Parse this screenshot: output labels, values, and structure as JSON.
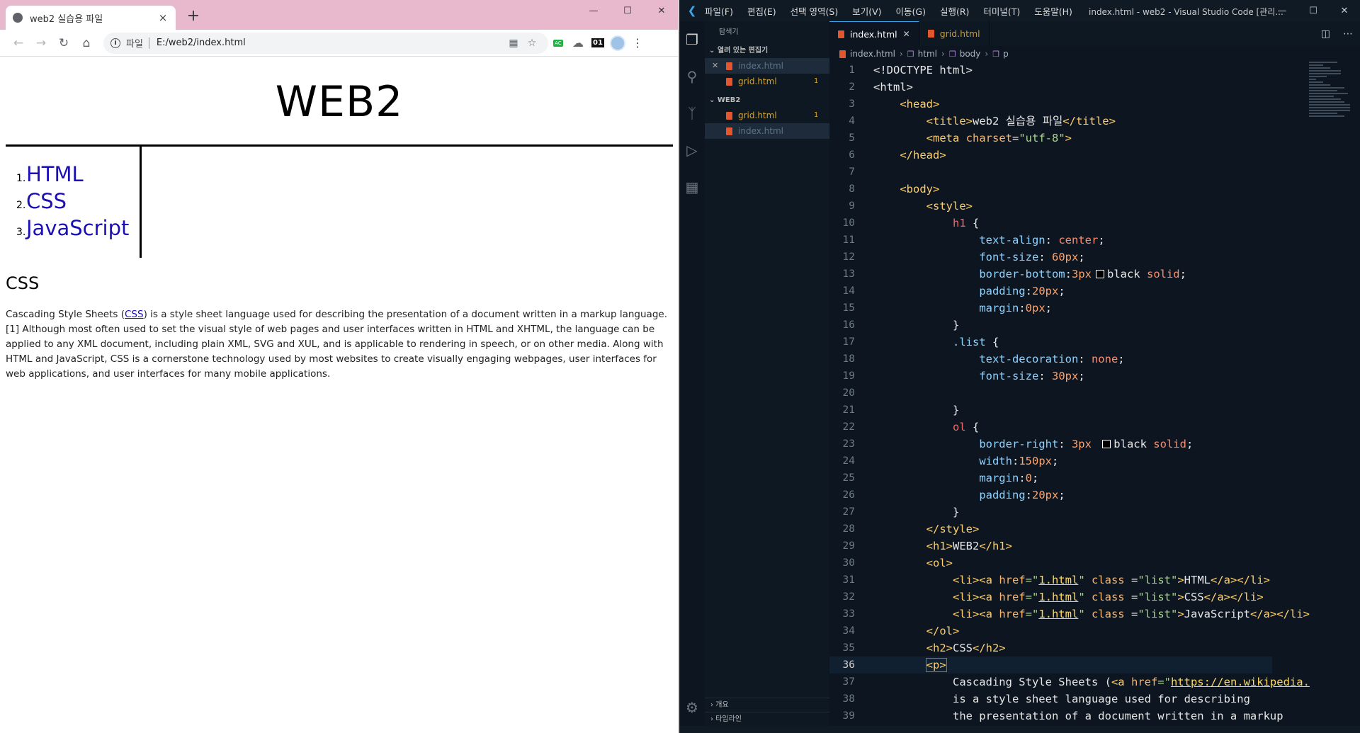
{
  "browser": {
    "tab_title": "web2 실습용 파일",
    "tab_close": "×",
    "new_tab": "+",
    "window_controls": [
      "—",
      "☐",
      "✕"
    ],
    "address_chip": "파일",
    "address_url": "E:/web2/index.html",
    "ext_ac": "AC",
    "ext_01": "01"
  },
  "page": {
    "h1": "WEB2",
    "list": [
      {
        "num": "1.",
        "label": "HTML"
      },
      {
        "num": "2.",
        "label": "CSS"
      },
      {
        "num": "3.",
        "label": "JavaScript"
      }
    ],
    "h2": "CSS",
    "p_before": "Cascading Style Sheets (",
    "p_link": "CSS",
    "p_after": ") is a style sheet language used for describing the presentation of a document written in a markup language.[1] Although most often used to set the visual style of web pages and user interfaces written in HTML and XHTML, the language can be applied to any XML document, including plain XML, SVG and XUL, and is applicable to rendering in speech, or on other media. Along with HTML and JavaScript, CSS is a cornerstone technology used by most websites to create visually engaging webpages, user interfaces for web applications, and user interfaces for many mobile applications."
  },
  "vscode": {
    "menu": [
      "파일(F)",
      "편집(E)",
      "선택 영역(S)",
      "보기(V)",
      "이동(G)",
      "실행(R)",
      "터미널(T)",
      "도움말(H)"
    ],
    "window_title": "index.html - web2 - Visual Studio Code [관리...",
    "explorer_header": "탐색기",
    "open_editors_label": "열려 있는 편집기",
    "open_editors": [
      {
        "name": "index.html",
        "badge": ""
      },
      {
        "name": "grid.html",
        "badge": "1"
      }
    ],
    "folder_label": "WEB2",
    "folder_files": [
      {
        "name": "grid.html",
        "badge": "1"
      },
      {
        "name": "index.html",
        "badge": ""
      }
    ],
    "outline_label": "개요",
    "timeline_label": "타임라인",
    "editor_tabs": [
      "index.html",
      "grid.html"
    ],
    "breadcrumbs": [
      "index.html",
      "html",
      "body",
      "p"
    ],
    "line_numbers": [
      "1",
      "2",
      "3",
      "4",
      "5",
      "6",
      "7",
      "8",
      "9",
      "10",
      "11",
      "12",
      "13",
      "14",
      "15",
      "16",
      "17",
      "18",
      "19",
      "20",
      "21",
      "22",
      "23",
      "24",
      "25",
      "26",
      "27",
      "28",
      "29",
      "30",
      "31",
      "32",
      "33",
      "34",
      "35",
      "36",
      "37",
      "38",
      "39"
    ],
    "code_plain": {
      "l1": "<!DOCTYPE html>",
      "l2": "<html>",
      "l3": "<head>",
      "l4a": "<title>",
      "l4b": "web2 실습용 파일",
      "l4c": "</title>",
      "l5a": "<meta ",
      "l5b": "charset",
      "l5c": "=",
      "l5d": "\"utf-8\"",
      "l5e": ">",
      "l6": "</head>",
      "l8": "<body>",
      "l9": "<style>",
      "l10a": "h1",
      "l10b": " {",
      "l11a": "text-align",
      "l11b": ": ",
      "l11c": "center",
      "l11d": ";",
      "l12a": "font-size",
      "l12b": ": ",
      "l12c": "60px",
      "l12d": ";",
      "l13a": "border-bottom",
      "l13b": ":",
      "l13c": "3px",
      "l13d": "black ",
      "l13e": "solid",
      "l13f": ";",
      "l14a": "padding",
      "l14b": ":",
      "l14c": "20px",
      "l14d": ";",
      "l15a": "margin",
      "l15b": ":",
      "l15c": "0px",
      "l15d": ";",
      "l16": "}",
      "l17a": ".list",
      "l17b": " {",
      "l18a": "text-decoration",
      "l18b": ": ",
      "l18c": "none",
      "l18d": ";",
      "l19a": "font-size",
      "l19b": ": ",
      "l19c": "30px",
      "l19d": ";",
      "l21": "}",
      "l22a": "ol",
      "l22b": " {",
      "l23a": "border-right",
      "l23b": ": ",
      "l23c": "3px ",
      "l23d": "black ",
      "l23e": "solid",
      "l23f": ";",
      "l24a": "width",
      "l24b": ":",
      "l24c": "150px",
      "l24d": ";",
      "l25a": "margin",
      "l25b": ":",
      "l25c": "0",
      "l25d": ";",
      "l26a": "padding",
      "l26b": ":",
      "l26c": "20px",
      "l26d": ";",
      "l27": "}",
      "l28": "</style>",
      "l29a": "<h1>",
      "l29b": "WEB2",
      "l29c": "</h1>",
      "l30": "<ol>",
      "l31a": "<li><a ",
      "l31b": "href",
      "l31c": "=\"",
      "l31d": "1.html",
      "l31e": "\" ",
      "l31f": "class",
      "l31g": " =",
      "l31h": "\"list\"",
      "l31i": ">",
      "l31j": "HTML",
      "l31k": "</a></li>",
      "l32a": "<li><a ",
      "l32b": "href",
      "l32c": "=\"",
      "l32d": "1.html",
      "l32e": "\" ",
      "l32f": "class",
      "l32g": " =",
      "l32h": "\"list\"",
      "l32i": ">",
      "l32j": "CSS",
      "l32k": "</a></li>",
      "l33a": "<li><a ",
      "l33b": "href",
      "l33c": "=\"",
      "l33d": "1.html",
      "l33e": "\" ",
      "l33f": "class",
      "l33g": " =",
      "l33h": "\"list\"",
      "l33i": ">",
      "l33j": "JavaScript",
      "l33k": "</a></li>",
      "l34": "</ol>",
      "l35a": "<h2>",
      "l35b": "CSS",
      "l35c": "</h2>",
      "l36": "<p>",
      "l37a": "Cascading Style Sheets (",
      "l37b": "<a ",
      "l37c": "href",
      "l37d": "=\"",
      "l37e": "https://en.wikipedia.",
      "l38": "is a style sheet language used for describing",
      "l39": "the presentation of a document written in a markup"
    }
  },
  "colors": {
    "browser_titlebar": "#e8b9cc",
    "link": "#1c0fb5",
    "vscode_bg": "#0d1620",
    "html_file_icon": "#e4572e"
  }
}
